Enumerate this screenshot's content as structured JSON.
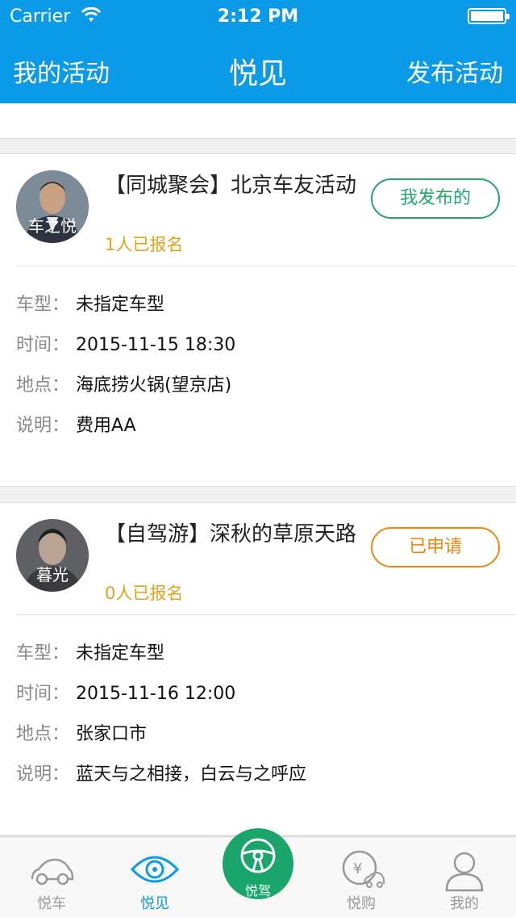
{
  "status_bar": {
    "carrier": "Carrier",
    "time": "2:12 PM"
  },
  "nav": {
    "left": "我的活动",
    "title": "悦见",
    "right": "发布活动"
  },
  "activities": [
    {
      "avatar_label": "车之悦",
      "title": "【同城聚会】北京车友活动",
      "count": "1人已报名",
      "status": "我发布的",
      "status_color": "#21a86a",
      "fields": [
        {
          "key": "车型：",
          "value": "未指定车型"
        },
        {
          "key": "时间：",
          "value": "2015-11-15 18:30"
        },
        {
          "key": "地点：",
          "value": "海底捞火锅(望京店)"
        },
        {
          "key": "说明：",
          "value": "费用AA"
        }
      ]
    },
    {
      "avatar_label": "暮光",
      "title": "【自驾游】深秋的草原天路",
      "count": "0人已报名",
      "status": "已申请",
      "status_color": "#f2860f",
      "fields": [
        {
          "key": "车型：",
          "value": "未指定车型"
        },
        {
          "key": "时间：",
          "value": "2015-11-16 12:00"
        },
        {
          "key": "地点：",
          "value": "张家口市"
        },
        {
          "key": "说明：",
          "value": "蓝天与之相接，白云与之呼应"
        }
      ]
    }
  ],
  "tabs": [
    {
      "label": "悦车",
      "icon": "car-icon"
    },
    {
      "label": "悦见",
      "icon": "eye-icon",
      "active": true
    },
    {
      "label": "悦驾",
      "icon": "steering-wheel-icon"
    },
    {
      "label": "悦购",
      "icon": "yuan-shopping-icon"
    },
    {
      "label": "我的",
      "icon": "person-icon"
    }
  ],
  "colors": {
    "header": "#0a9ae8",
    "accent_green": "#1aa66b",
    "count_orange": "#e3a21a"
  }
}
